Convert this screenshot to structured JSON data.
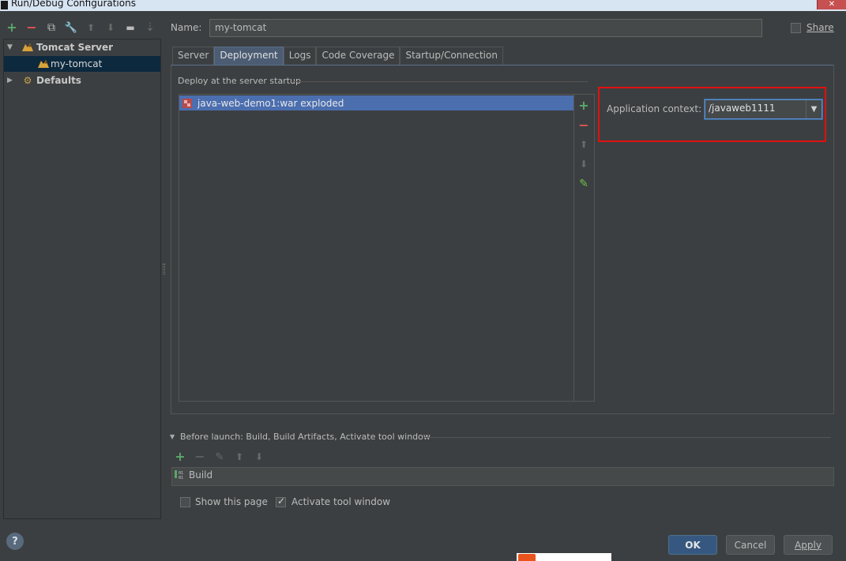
{
  "window": {
    "title": "Run/Debug Configurations",
    "close_glyph": "✕"
  },
  "tree": {
    "toolbar": [
      {
        "icon": "add-icon",
        "glyph": "+",
        "color": "#59a869"
      },
      {
        "icon": "remove-icon",
        "glyph": "−",
        "color": "#e05555"
      },
      {
        "icon": "copy-icon",
        "glyph": "⧉",
        "color": "#bbbbbb"
      },
      {
        "icon": "wrench-icon",
        "glyph": "🔧",
        "color": "#c9a04a"
      },
      {
        "icon": "move-up-icon",
        "glyph": "⬆",
        "color": "#6a6a6a"
      },
      {
        "icon": "move-down-icon",
        "glyph": "⬇",
        "color": "#6a6a6a"
      },
      {
        "icon": "folder-icon",
        "glyph": "▬",
        "color": "#bbbbbb"
      },
      {
        "icon": "sort-icon",
        "glyph": "⇣",
        "color": "#6a6a6a"
      }
    ],
    "items": [
      {
        "label": "Tomcat Server",
        "arrow": "▼"
      },
      {
        "label": "my-tomcat"
      },
      {
        "label": "Defaults",
        "arrow": "▶"
      }
    ]
  },
  "form": {
    "name_label": "Name:",
    "name_value": "my-tomcat",
    "share_label": "Share",
    "share_checked": false
  },
  "tabs": [
    {
      "label": "Server"
    },
    {
      "label": "Deployment",
      "active": true
    },
    {
      "label": "Logs"
    },
    {
      "label": "Code Coverage"
    },
    {
      "label": "Startup/Connection"
    }
  ],
  "deployment": {
    "group_title": "Deploy at the server startup",
    "artifacts": [
      {
        "label": "java-web-demo1:war exploded"
      }
    ],
    "side_buttons": [
      {
        "icon": "add-icon",
        "glyph": "+",
        "color": "#59a869"
      },
      {
        "icon": "remove-icon",
        "glyph": "−",
        "color": "#e05555"
      },
      {
        "icon": "move-up-icon",
        "glyph": "⬆",
        "color": "#6a6a6a"
      },
      {
        "icon": "move-down-icon",
        "glyph": "⬇",
        "color": "#6a6a6a"
      },
      {
        "icon": "edit-icon",
        "glyph": "✎",
        "color": "#6fbf4a"
      }
    ],
    "app_context_label": "Application context:",
    "app_context_value": "/javaweb1111",
    "dropdown_glyph": "▼"
  },
  "before_launch": {
    "arrow": "▼",
    "title": "Before launch: Build, Build Artifacts, Activate tool window",
    "toolbar": [
      {
        "icon": "add-icon",
        "glyph": "+",
        "color": "#59a869"
      },
      {
        "icon": "remove-icon",
        "glyph": "−",
        "color": "#6a6a6a"
      },
      {
        "icon": "edit-icon",
        "glyph": "✎",
        "color": "#6a6a6a"
      },
      {
        "icon": "move-up-icon",
        "glyph": "⬆",
        "color": "#6a6a6a"
      },
      {
        "icon": "move-down-icon",
        "glyph": "⬇",
        "color": "#6a6a6a"
      }
    ],
    "tasks": [
      {
        "label": "Build"
      }
    ],
    "show_page_label": "Show this page",
    "show_page_checked": false,
    "activate_label": "Activate tool window",
    "activate_checked": true
  },
  "buttons": {
    "ok": "OK",
    "cancel": "Cancel",
    "apply": "Apply",
    "help": "?"
  },
  "colors": {
    "background": "#3c3f41",
    "selection": "#4b6eaf",
    "highlight_box": "#e01010",
    "primary_button": "#365880"
  }
}
